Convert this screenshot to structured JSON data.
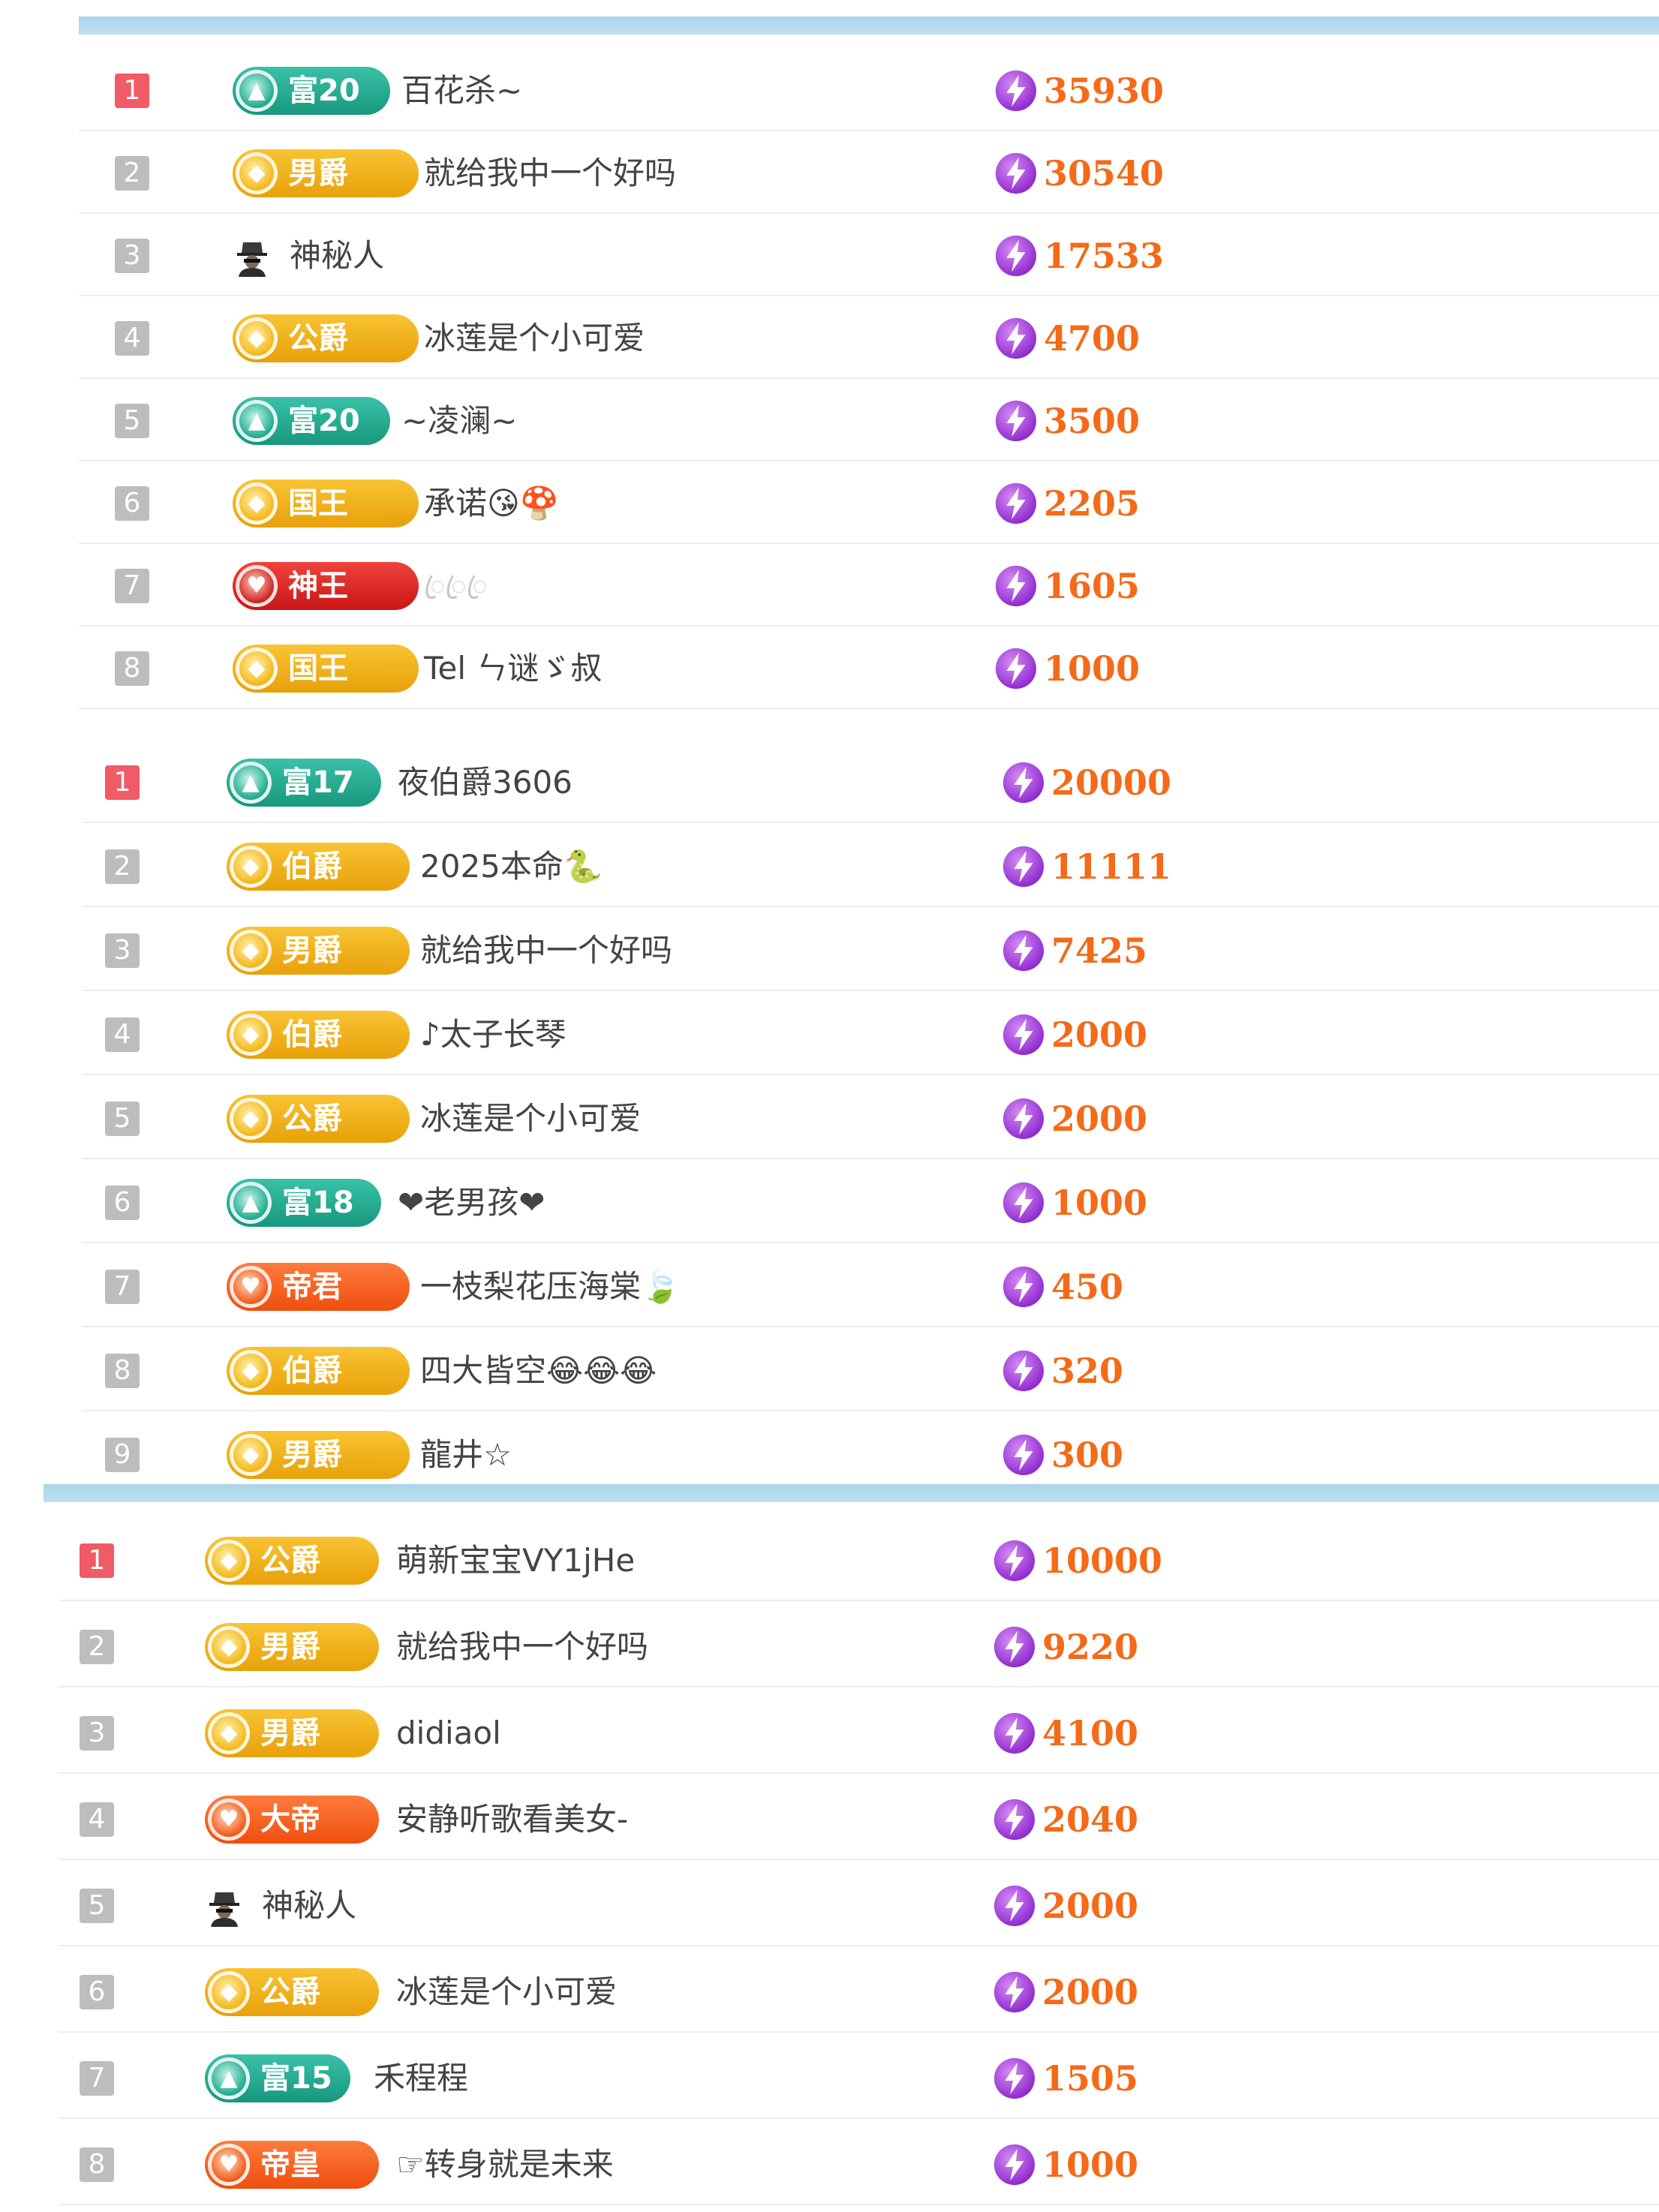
{
  "colors": {
    "rank_first": "#f15a67",
    "rank_default": "#bdbdbd",
    "score_text": "#f46a18",
    "bolt": "#9b35d6",
    "divider_strip": "#a8d4ea"
  },
  "icons": {
    "rank_score": "lightning-bolt-icon",
    "mystery_user": "spy-hat-icon",
    "badge_emblem": "badge-emblem-icon"
  },
  "panels": [
    {
      "rows": [
        {
          "rank": "1",
          "badge": "富20",
          "badge_style": "teal",
          "name": "百花杀~",
          "score": "35930"
        },
        {
          "rank": "2",
          "badge": "男爵",
          "badge_style": "gold",
          "name": "就给我中一个好吗",
          "score": "30540"
        },
        {
          "rank": "3",
          "badge": "",
          "badge_style": "mystery",
          "name": "神秘人",
          "score": "17533"
        },
        {
          "rank": "4",
          "badge": "公爵",
          "badge_style": "gold",
          "name": "冰莲是个小可爱",
          "score": "4700"
        },
        {
          "rank": "5",
          "badge": "富20",
          "badge_style": "teal",
          "name": "~凌澜~",
          "score": "3500"
        },
        {
          "rank": "6",
          "badge": "国王",
          "badge_style": "gold",
          "name": "承诺😘🍄",
          "score": "2205"
        },
        {
          "rank": "7",
          "badge": "神王",
          "badge_style": "red",
          "name": "ꦿꦿꦿ",
          "score": "1605"
        },
        {
          "rank": "8",
          "badge": "国王",
          "badge_style": "gold",
          "name": "Tel ㄣ谜ゞ叔",
          "score": "1000"
        }
      ]
    },
    {
      "rows": [
        {
          "rank": "1",
          "badge": "富17",
          "badge_style": "teal",
          "name": "夜伯爵3606",
          "score": "20000"
        },
        {
          "rank": "2",
          "badge": "伯爵",
          "badge_style": "gold",
          "name": "2025本命🐍",
          "score": "11111"
        },
        {
          "rank": "3",
          "badge": "男爵",
          "badge_style": "gold",
          "name": "就给我中一个好吗",
          "score": "7425"
        },
        {
          "rank": "4",
          "badge": "伯爵",
          "badge_style": "gold",
          "name": "♪太子长琴",
          "score": "2000"
        },
        {
          "rank": "5",
          "badge": "公爵",
          "badge_style": "gold",
          "name": "冰莲是个小可爱",
          "score": "2000"
        },
        {
          "rank": "6",
          "badge": "富18",
          "badge_style": "teal",
          "name": "❤老男孩❤",
          "score": "1000"
        },
        {
          "rank": "7",
          "badge": "帝君",
          "badge_style": "orange",
          "name": "一枝梨花压海棠🍃",
          "score": "450"
        },
        {
          "rank": "8",
          "badge": "伯爵",
          "badge_style": "gold",
          "name": "四大皆空😂😂😂",
          "score": "320"
        },
        {
          "rank": "9",
          "badge": "男爵",
          "badge_style": "gold",
          "name": "龍井☆",
          "score": "300"
        }
      ]
    },
    {
      "rows": [
        {
          "rank": "1",
          "badge": "公爵",
          "badge_style": "gold",
          "name": "萌新宝宝VY1jHe",
          "score": "10000"
        },
        {
          "rank": "2",
          "badge": "男爵",
          "badge_style": "gold",
          "name": "就给我中一个好吗",
          "score": "9220"
        },
        {
          "rank": "3",
          "badge": "男爵",
          "badge_style": "gold",
          "name": "didiaol",
          "score": "4100"
        },
        {
          "rank": "4",
          "badge": "大帝",
          "badge_style": "orange",
          "name": "安静听歌看美女-",
          "score": "2040"
        },
        {
          "rank": "5",
          "badge": "",
          "badge_style": "mystery",
          "name": "神秘人",
          "score": "2000"
        },
        {
          "rank": "6",
          "badge": "公爵",
          "badge_style": "gold",
          "name": "冰莲是个小可爱",
          "score": "2000"
        },
        {
          "rank": "7",
          "badge": "富15",
          "badge_style": "teal",
          "name": "禾程程",
          "score": "1505"
        },
        {
          "rank": "8",
          "badge": "帝皇",
          "badge_style": "orange",
          "name": "☞转身就是未来",
          "score": "1000"
        }
      ]
    }
  ]
}
